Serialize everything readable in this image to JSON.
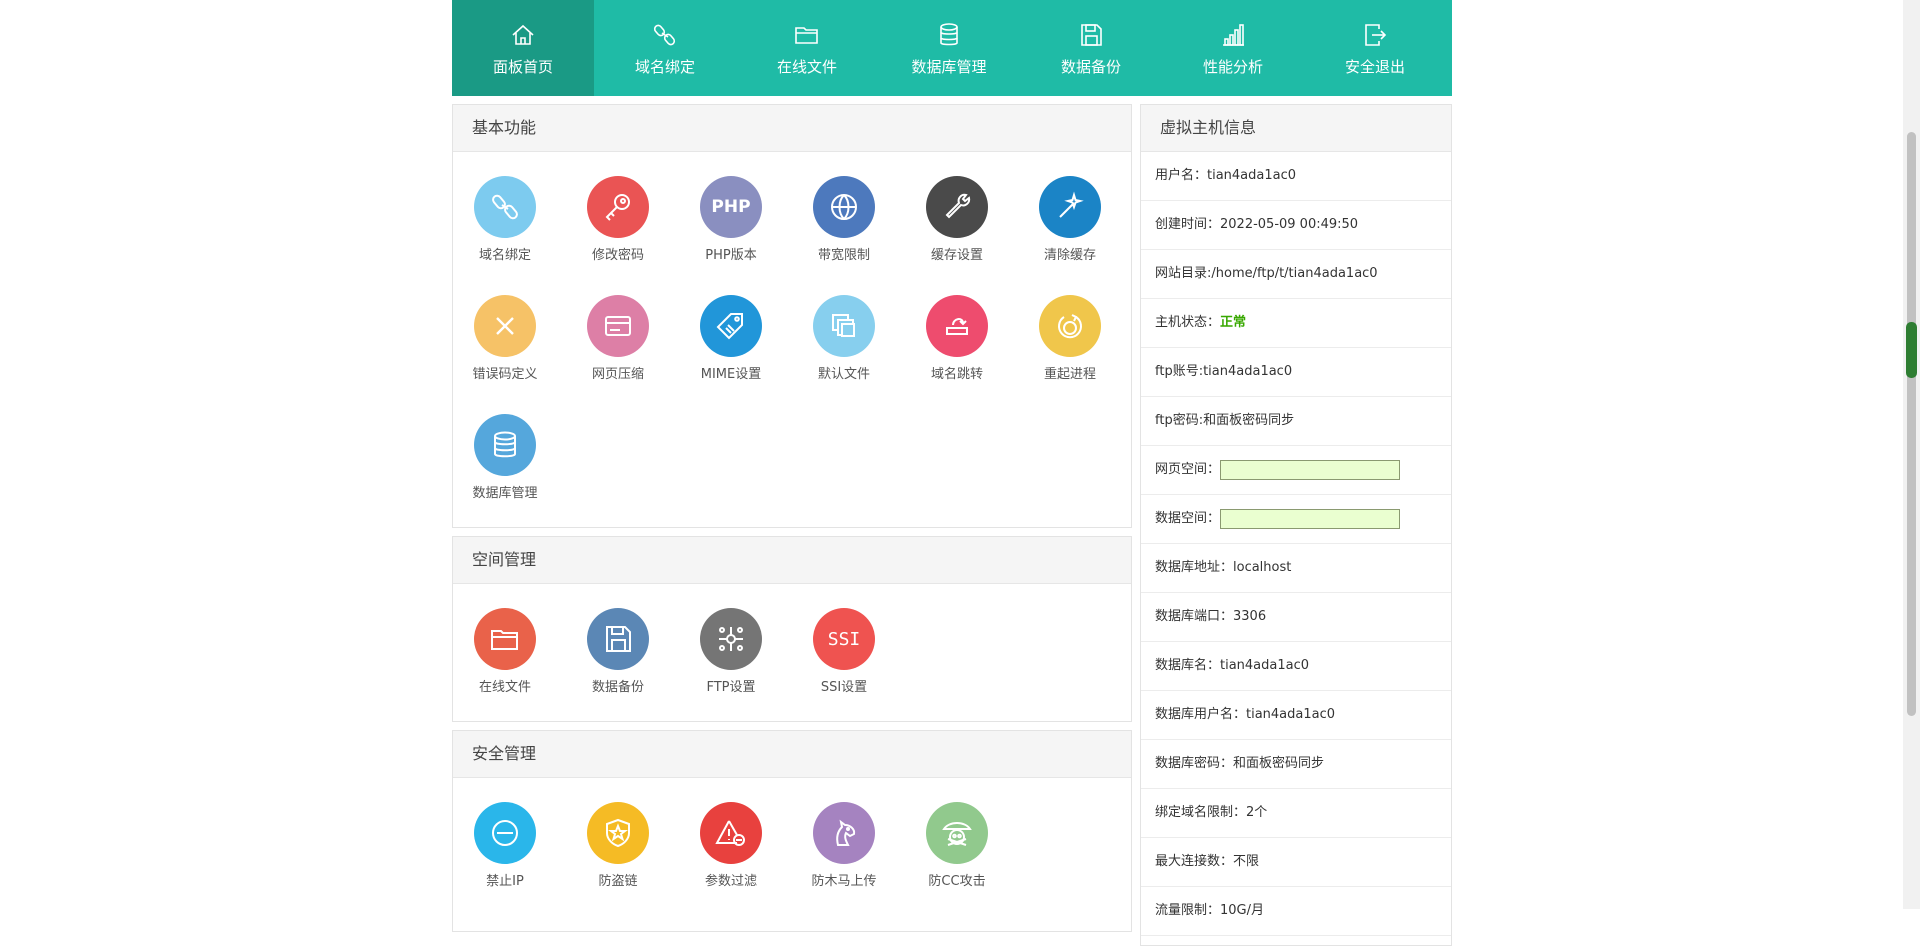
{
  "nav": [
    {
      "label": "面板首页",
      "icon": "home-icon",
      "active": true
    },
    {
      "label": "域名绑定",
      "icon": "link-icon"
    },
    {
      "label": "在线文件",
      "icon": "folder-icon"
    },
    {
      "label": "数据库管理",
      "icon": "database-icon"
    },
    {
      "label": "数据备份",
      "icon": "save-icon"
    },
    {
      "label": "性能分析",
      "icon": "bar-chart-icon"
    },
    {
      "label": "安全退出",
      "icon": "logout-icon"
    }
  ],
  "basic": {
    "title": "基本功能",
    "items": [
      {
        "label": "域名绑定",
        "icon": "link-icon",
        "color": "#7dcbef"
      },
      {
        "label": "修改密码",
        "icon": "key-icon",
        "color": "#ea5454"
      },
      {
        "label": "PHP版本",
        "icon": "php-icon",
        "color": "#8a8fc0",
        "text": "PHP"
      },
      {
        "label": "带宽限制",
        "icon": "globe-icon",
        "color": "#4d79bd"
      },
      {
        "label": "缓存设置",
        "icon": "wrench-icon",
        "color": "#4a4a4a"
      },
      {
        "label": "清除缓存",
        "icon": "magic-wand-icon",
        "color": "#1b84c6"
      },
      {
        "label": "错误码定义",
        "icon": "close-icon",
        "color": "#f6c267"
      },
      {
        "label": "网页压缩",
        "icon": "card-icon",
        "color": "#dd7fa6"
      },
      {
        "label": "MIME设置",
        "icon": "tag-icon",
        "color": "#2196d9"
      },
      {
        "label": "默认文件",
        "icon": "copy-icon",
        "color": "#87cfee"
      },
      {
        "label": "域名跳转",
        "icon": "redirect-icon",
        "color": "#ee4c6e"
      },
      {
        "label": "重起进程",
        "icon": "restart-icon",
        "color": "#f0c64b"
      },
      {
        "label": "数据库管理",
        "icon": "database-icon",
        "color": "#55a7dc"
      }
    ]
  },
  "space": {
    "title": "空间管理",
    "items": [
      {
        "label": "在线文件",
        "icon": "folder-icon",
        "color": "#e9624a"
      },
      {
        "label": "数据备份",
        "icon": "save-icon",
        "color": "#5b87b5"
      },
      {
        "label": "FTP设置",
        "icon": "network-icon",
        "color": "#757575"
      },
      {
        "label": "SSI设置",
        "icon": "ssi-icon",
        "color": "#ef5350",
        "text": "SSI"
      }
    ]
  },
  "security": {
    "title": "安全管理",
    "items": [
      {
        "label": "禁止IP",
        "icon": "ban-icon",
        "color": "#2ab6ea"
      },
      {
        "label": "防盗链",
        "icon": "shield-star-icon",
        "color": "#f5bb25"
      },
      {
        "label": "参数过滤",
        "icon": "warning-icon",
        "color": "#e8413e"
      },
      {
        "label": "防木马上传",
        "icon": "horse-icon",
        "color": "#a583c0"
      },
      {
        "label": "防CC攻击",
        "icon": "pirate-icon",
        "color": "#91c98d"
      }
    ]
  },
  "info": {
    "title": "虚拟主机信息",
    "username": "用户名：tian4ada1ac0",
    "created": "创建时间：2022-05-09 00:49:50",
    "site_dir": "网站目录:/home/ftp/t/tian4ada1ac0",
    "status_label": "主机状态：",
    "status_value": "正常",
    "ftp_user": "ftp账号:tian4ada1ac0",
    "ftp_pass": "ftp密码:和面板密码同步",
    "web_space": "网页空间：",
    "web_space_used": 0,
    "db_space": "数据空间：",
    "db_space_used": 0,
    "db_host": "数据库地址：localhost",
    "db_port": "数据库端口：3306",
    "db_name": "数据库名：tian4ada1ac0",
    "db_user": "数据库用户名：tian4ada1ac0",
    "db_pass": "数据库密码：和面板密码同步",
    "domain_limit": "绑定域名限制：2个",
    "max_conn": "最大连接数：不限",
    "traffic": "流量限制：10G/月"
  }
}
